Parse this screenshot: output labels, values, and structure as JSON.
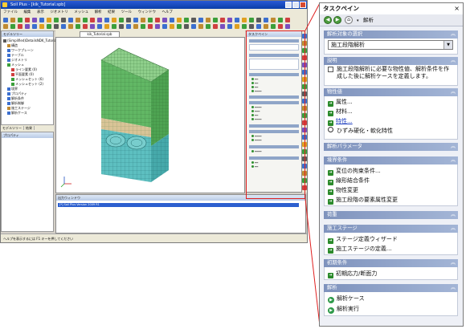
{
  "app": {
    "title": "Soil Plus - [kik_Tutorial.spb]",
    "menu": [
      "ファイル",
      "編集",
      "表示",
      "ジオメトリ",
      "メッシュ",
      "解析",
      "結果",
      "ツール",
      "ウィンドウ",
      "ヘルプ"
    ],
    "model_panel_title": "モデルツリー",
    "tree": [
      {
        "label": "(Simplified)DetailsNDK_Tutorial.spb",
        "indent": 0,
        "color": "#5a5a5a"
      },
      {
        "label": "構造",
        "indent": 1,
        "color": "#c08a30"
      },
      {
        "label": "ワークプレーン",
        "indent": 1,
        "color": "#3b6fcf"
      },
      {
        "label": "テーブル",
        "indent": 1,
        "color": "#3b6fcf"
      },
      {
        "label": "ジオメトリ",
        "indent": 1,
        "color": "#3b6fcf"
      },
      {
        "label": "メッシュ",
        "indent": 1,
        "color": "#3b9f3b"
      },
      {
        "label": "ライン要素 (0)",
        "indent": 2,
        "color": "#d04040"
      },
      {
        "label": "平面要素 (0)",
        "indent": 2,
        "color": "#d04040"
      },
      {
        "label": "メッシュセット (6)",
        "indent": 2,
        "color": "#3b9f3b"
      },
      {
        "label": "メッシュセット (2)",
        "indent": 2,
        "color": "#3b9f3b"
      },
      {
        "label": "境界",
        "indent": 1,
        "color": "#3b6fcf"
      },
      {
        "label": "プロパティ",
        "indent": 1,
        "color": "#3b6fcf"
      },
      {
        "label": "解析条件",
        "indent": 1,
        "color": "#3b6fcf"
      },
      {
        "label": "解析制御",
        "indent": 1,
        "color": "#3b6fcf"
      },
      {
        "label": "施工ステージ",
        "indent": 1,
        "color": "#c08a30"
      },
      {
        "label": "解析ケース",
        "indent": 1,
        "color": "#3b6fcf"
      }
    ],
    "left_tabs": [
      "モデルツリー",
      "結果"
    ],
    "property_title": "プロパティ",
    "doc_tab": "kik_Tutorial.spb",
    "output_title": "出力ウィンドウ",
    "output_line": "[*] Soil Plus Version 2009 R1",
    "status": "ヘルプを表示するには F1 キーを押してください",
    "small_pane_title": "タスクペイン"
  },
  "task_pane": {
    "title": "タスクペイン",
    "close": "×",
    "nav_back": "◀",
    "nav_forward": "▶",
    "nav_home": "⌂",
    "nav_dropdown": "▾",
    "nav_label": "解析",
    "sections": {
      "target": {
        "header": "解析対象の選択",
        "select_value": "施工段階解析"
      },
      "description": {
        "header": "説明",
        "text": "施工段階解析に必要な物性値、解析条件を作成した後に解析ケースを定義します。"
      },
      "property": {
        "header": "物性値",
        "items": [
          "属性...",
          "材料...",
          "特性...",
          "ひずみ硬化・軟化特性"
        ]
      },
      "analysis_param": {
        "header": "解析パラメータ"
      },
      "boundary": {
        "header": "境界条件",
        "items": [
          "変位の拘束条件...",
          "線形結合条件",
          "物性変更",
          "施工段階の要素属性変更"
        ]
      },
      "load": {
        "header": "荷重"
      },
      "stage": {
        "header": "施工ステージ",
        "items": [
          "ステージ定義ウィザード",
          "施工ステージの定義..."
        ]
      },
      "initial": {
        "header": "初期条件",
        "items": [
          "初期応力/断面力"
        ]
      },
      "analysis": {
        "header": "解析",
        "items": [
          "解析ケース",
          "解析実行"
        ]
      }
    }
  },
  "colors": {
    "highlight": "#e02020",
    "accent_band": "#8fa3cc",
    "link": "#2040c0",
    "soil_top": "#62b765",
    "soil_mid": "#d8c497",
    "soil_bottom": "#5dbfc0"
  }
}
